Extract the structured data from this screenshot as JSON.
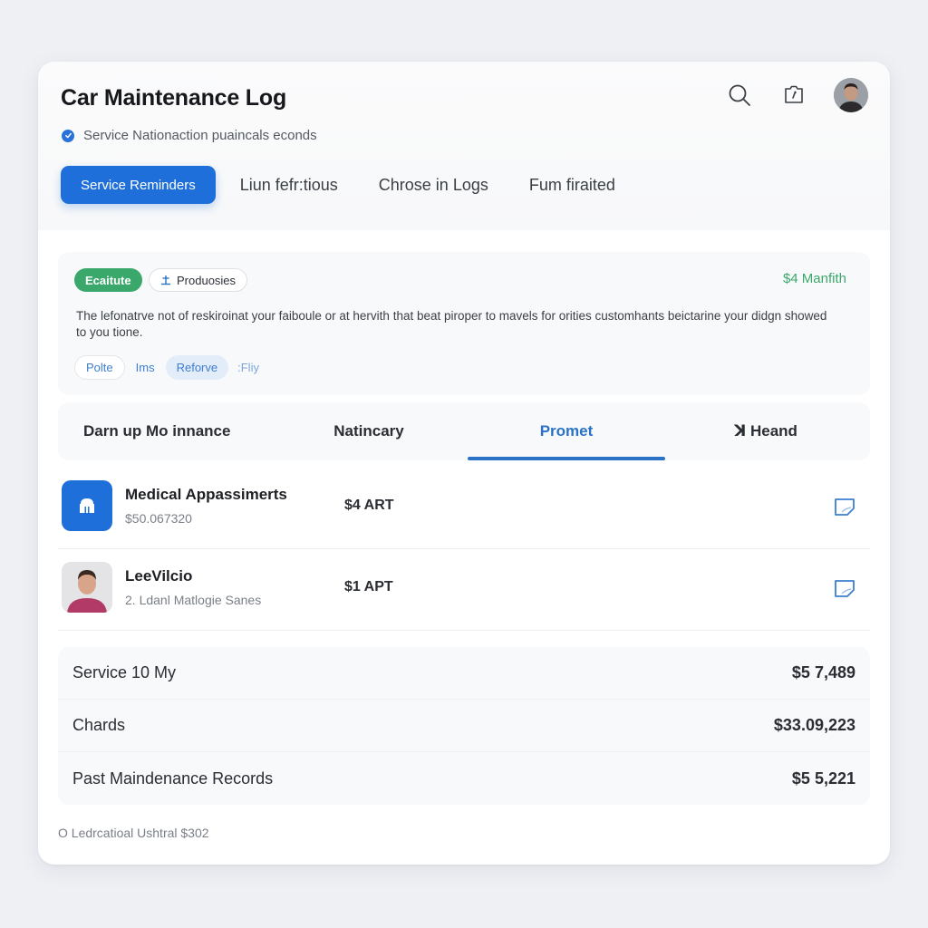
{
  "header": {
    "title": "Car Maintenance Log",
    "subtitle": "Service Nationaction puaincals econds",
    "icons": [
      "search-icon",
      "camera-icon",
      "avatar"
    ]
  },
  "top_tabs": [
    {
      "label": "Service Reminders",
      "active": true
    },
    {
      "label": "Liun fefr:tious",
      "active": false
    },
    {
      "label": "Chrose in Logs",
      "active": false
    },
    {
      "label": "Fum firaited",
      "active": false
    }
  ],
  "promo": {
    "badge_primary": "Ecaitute",
    "badge_secondary": "Produosies",
    "price": "$4 Manfith",
    "text": "The lefonatrve not of reskiroinat your faiboule or at hervith that beat piroper to mavels for orities customhants beictarine your didgn showed to you tione.",
    "chips": [
      {
        "label": "Polte",
        "style": "outlined"
      },
      {
        "label": "Ims",
        "style": "plain"
      },
      {
        "label": "Reforve",
        "style": "active"
      },
      {
        "label": ":Fliy",
        "style": "faint"
      }
    ]
  },
  "section_tabs": [
    {
      "label": "Darn up Mo innance",
      "active": false
    },
    {
      "label": "Natincary",
      "active": false
    },
    {
      "label": "Promet",
      "active": true
    },
    {
      "label": "ꓘ Heand",
      "active": false
    }
  ],
  "list": [
    {
      "title": "Medical Appassimerts",
      "subtitle": "$50.067320",
      "amount": "$4 ART",
      "icon": "building-icon"
    },
    {
      "title": "LeeVilcio",
      "subtitle": "2. Ldanl Matlogie Sanes",
      "amount": "$1 APT",
      "icon": "person-avatar"
    }
  ],
  "summary": [
    {
      "label": "Service 10 My",
      "value": "$5 7,489"
    },
    {
      "label": "Chards",
      "value": "$33.09,223"
    },
    {
      "label": "Past Maindenance Records",
      "value": "$5 5,221"
    }
  ],
  "footer": "O Ledrcatioal Ushtral $302",
  "colors": {
    "accent": "#1f6fdb",
    "success": "#3aa86b",
    "background": "#eef0f4"
  }
}
